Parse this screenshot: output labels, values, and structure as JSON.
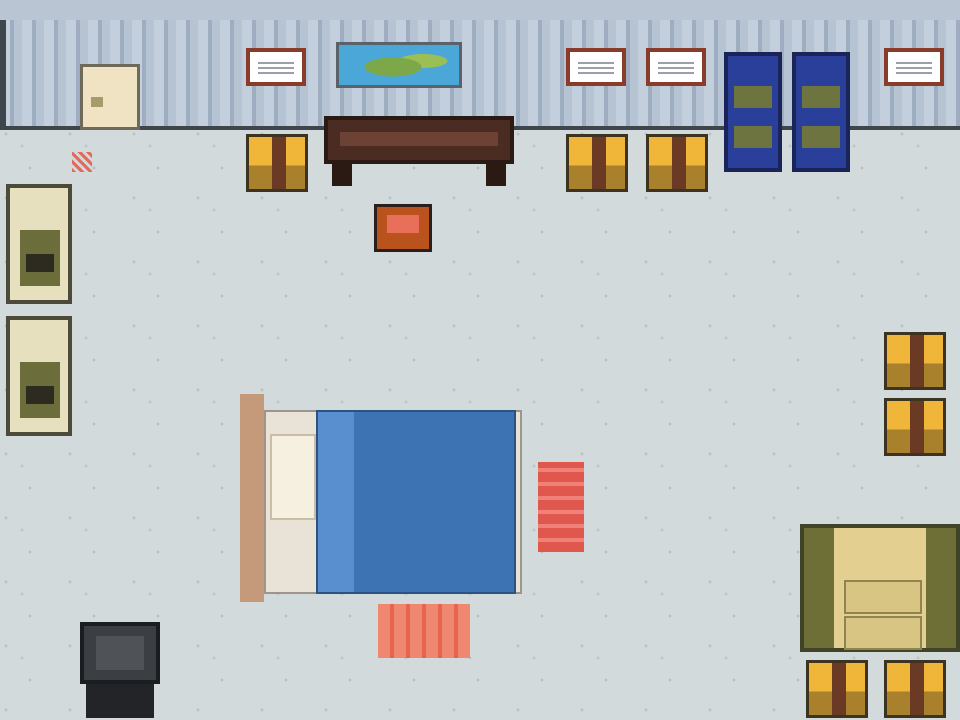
{
  "scene": {
    "name": "bedroom",
    "palette": {
      "floor": "#d3dadb",
      "wall": "#aebccd",
      "sign_frame": "#8a3c2a",
      "table": "#4a2c22",
      "chest_gold": "#f0b63a",
      "blanket": "#3e73b3",
      "rug": "#e0574d"
    },
    "objects": [
      "wall-sign",
      "world-map",
      "door",
      "coffee-table",
      "storage-chest",
      "footstool",
      "bookshelf",
      "locker",
      "bed",
      "rug",
      "television",
      "sofa"
    ]
  }
}
